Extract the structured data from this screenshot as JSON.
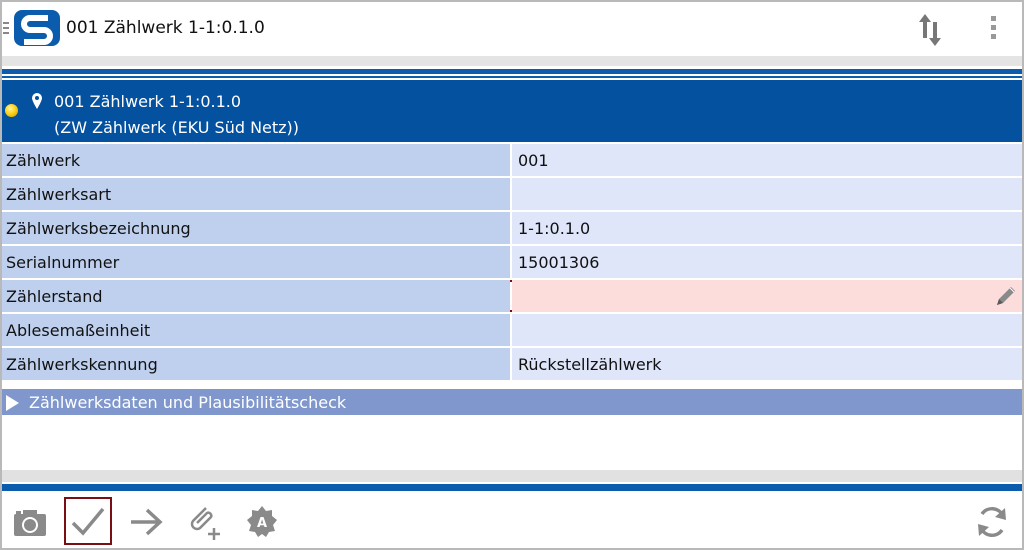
{
  "app": {
    "title": "001 Zählwerk 1-1:0.1.0",
    "icons": [
      "menu-icon",
      "app-logo",
      "sort-arrows-icon",
      "overflow-menu-icon"
    ]
  },
  "header": {
    "line1": "001 Zählwerk 1-1:0.1.0",
    "line2": "(ZW Zählwerk (EKU Süd Netz))",
    "status_color": "#ffd21a"
  },
  "fields": [
    {
      "label": "Zählwerk",
      "value": "001"
    },
    {
      "label": "Zählwerksart",
      "value": ""
    },
    {
      "label": "Zählwerksbezeichnung",
      "value": "1-1:0.1.0"
    },
    {
      "label": "Serialnummer",
      "value": "15001306"
    },
    {
      "label": "Zählerstand",
      "value": ""
    },
    {
      "label": "Ablesemaßeinheit",
      "value": ""
    },
    {
      "label": "Zählwerkskennung",
      "value": "Rückstellzählwerk"
    }
  ],
  "section": {
    "label": "Zählwerksdaten und Plausibilitätscheck",
    "expanded": false
  },
  "toolbar": {
    "icons": [
      "camera-icon",
      "checkmark-icon",
      "arrow-right-icon",
      "attachment-add-icon",
      "auto-badge-icon",
      "refresh-icon"
    ]
  },
  "colors": {
    "primary": "#04519f",
    "label_cell": "#bfd0ef",
    "value_cell": "#dfe6fa",
    "edit_cell": "#fddcdc",
    "edit_border": "#7a0e17",
    "section": "#7f97cc"
  }
}
